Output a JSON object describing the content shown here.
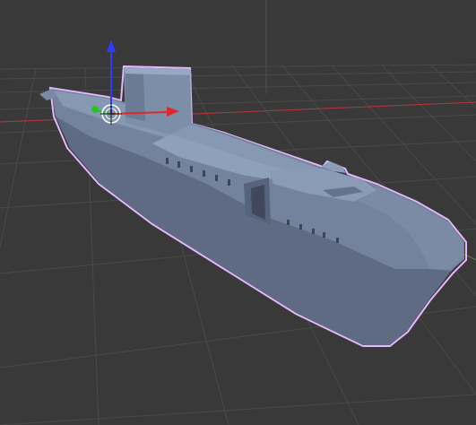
{
  "viewport": {
    "background": "#393939",
    "grid_color": "#4a4a4a",
    "x_axis_color": "#b23b3b",
    "y_axis_color": "#5a8c3a",
    "z_axis_color": "#3c4e7a"
  },
  "model": {
    "name": "submarine",
    "body_color": "#6f7f99",
    "body_dark": "#56637a",
    "body_light": "#8a9bb5",
    "selection_outline_color": "#e6b8ff"
  },
  "gizmo": {
    "x_handle_color": "#e02828",
    "y_handle_color": "#27c427",
    "z_handle_color": "#2a3cff",
    "pivot_color": "#ffffff"
  }
}
